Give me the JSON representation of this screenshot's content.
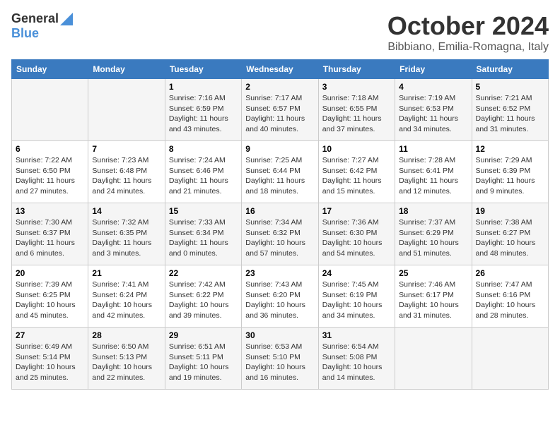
{
  "logo": {
    "general": "General",
    "blue": "Blue"
  },
  "title": {
    "month": "October 2024",
    "location": "Bibbiano, Emilia-Romagna, Italy"
  },
  "days_of_week": [
    "Sunday",
    "Monday",
    "Tuesday",
    "Wednesday",
    "Thursday",
    "Friday",
    "Saturday"
  ],
  "weeks": [
    [
      {
        "day": "",
        "info": ""
      },
      {
        "day": "",
        "info": ""
      },
      {
        "day": "1",
        "info": "Sunrise: 7:16 AM\nSunset: 6:59 PM\nDaylight: 11 hours and 43 minutes."
      },
      {
        "day": "2",
        "info": "Sunrise: 7:17 AM\nSunset: 6:57 PM\nDaylight: 11 hours and 40 minutes."
      },
      {
        "day": "3",
        "info": "Sunrise: 7:18 AM\nSunset: 6:55 PM\nDaylight: 11 hours and 37 minutes."
      },
      {
        "day": "4",
        "info": "Sunrise: 7:19 AM\nSunset: 6:53 PM\nDaylight: 11 hours and 34 minutes."
      },
      {
        "day": "5",
        "info": "Sunrise: 7:21 AM\nSunset: 6:52 PM\nDaylight: 11 hours and 31 minutes."
      }
    ],
    [
      {
        "day": "6",
        "info": "Sunrise: 7:22 AM\nSunset: 6:50 PM\nDaylight: 11 hours and 27 minutes."
      },
      {
        "day": "7",
        "info": "Sunrise: 7:23 AM\nSunset: 6:48 PM\nDaylight: 11 hours and 24 minutes."
      },
      {
        "day": "8",
        "info": "Sunrise: 7:24 AM\nSunset: 6:46 PM\nDaylight: 11 hours and 21 minutes."
      },
      {
        "day": "9",
        "info": "Sunrise: 7:25 AM\nSunset: 6:44 PM\nDaylight: 11 hours and 18 minutes."
      },
      {
        "day": "10",
        "info": "Sunrise: 7:27 AM\nSunset: 6:42 PM\nDaylight: 11 hours and 15 minutes."
      },
      {
        "day": "11",
        "info": "Sunrise: 7:28 AM\nSunset: 6:41 PM\nDaylight: 11 hours and 12 minutes."
      },
      {
        "day": "12",
        "info": "Sunrise: 7:29 AM\nSunset: 6:39 PM\nDaylight: 11 hours and 9 minutes."
      }
    ],
    [
      {
        "day": "13",
        "info": "Sunrise: 7:30 AM\nSunset: 6:37 PM\nDaylight: 11 hours and 6 minutes."
      },
      {
        "day": "14",
        "info": "Sunrise: 7:32 AM\nSunset: 6:35 PM\nDaylight: 11 hours and 3 minutes."
      },
      {
        "day": "15",
        "info": "Sunrise: 7:33 AM\nSunset: 6:34 PM\nDaylight: 11 hours and 0 minutes."
      },
      {
        "day": "16",
        "info": "Sunrise: 7:34 AM\nSunset: 6:32 PM\nDaylight: 10 hours and 57 minutes."
      },
      {
        "day": "17",
        "info": "Sunrise: 7:36 AM\nSunset: 6:30 PM\nDaylight: 10 hours and 54 minutes."
      },
      {
        "day": "18",
        "info": "Sunrise: 7:37 AM\nSunset: 6:29 PM\nDaylight: 10 hours and 51 minutes."
      },
      {
        "day": "19",
        "info": "Sunrise: 7:38 AM\nSunset: 6:27 PM\nDaylight: 10 hours and 48 minutes."
      }
    ],
    [
      {
        "day": "20",
        "info": "Sunrise: 7:39 AM\nSunset: 6:25 PM\nDaylight: 10 hours and 45 minutes."
      },
      {
        "day": "21",
        "info": "Sunrise: 7:41 AM\nSunset: 6:24 PM\nDaylight: 10 hours and 42 minutes."
      },
      {
        "day": "22",
        "info": "Sunrise: 7:42 AM\nSunset: 6:22 PM\nDaylight: 10 hours and 39 minutes."
      },
      {
        "day": "23",
        "info": "Sunrise: 7:43 AM\nSunset: 6:20 PM\nDaylight: 10 hours and 36 minutes."
      },
      {
        "day": "24",
        "info": "Sunrise: 7:45 AM\nSunset: 6:19 PM\nDaylight: 10 hours and 34 minutes."
      },
      {
        "day": "25",
        "info": "Sunrise: 7:46 AM\nSunset: 6:17 PM\nDaylight: 10 hours and 31 minutes."
      },
      {
        "day": "26",
        "info": "Sunrise: 7:47 AM\nSunset: 6:16 PM\nDaylight: 10 hours and 28 minutes."
      }
    ],
    [
      {
        "day": "27",
        "info": "Sunrise: 6:49 AM\nSunset: 5:14 PM\nDaylight: 10 hours and 25 minutes."
      },
      {
        "day": "28",
        "info": "Sunrise: 6:50 AM\nSunset: 5:13 PM\nDaylight: 10 hours and 22 minutes."
      },
      {
        "day": "29",
        "info": "Sunrise: 6:51 AM\nSunset: 5:11 PM\nDaylight: 10 hours and 19 minutes."
      },
      {
        "day": "30",
        "info": "Sunrise: 6:53 AM\nSunset: 5:10 PM\nDaylight: 10 hours and 16 minutes."
      },
      {
        "day": "31",
        "info": "Sunrise: 6:54 AM\nSunset: 5:08 PM\nDaylight: 10 hours and 14 minutes."
      },
      {
        "day": "",
        "info": ""
      },
      {
        "day": "",
        "info": ""
      }
    ]
  ]
}
